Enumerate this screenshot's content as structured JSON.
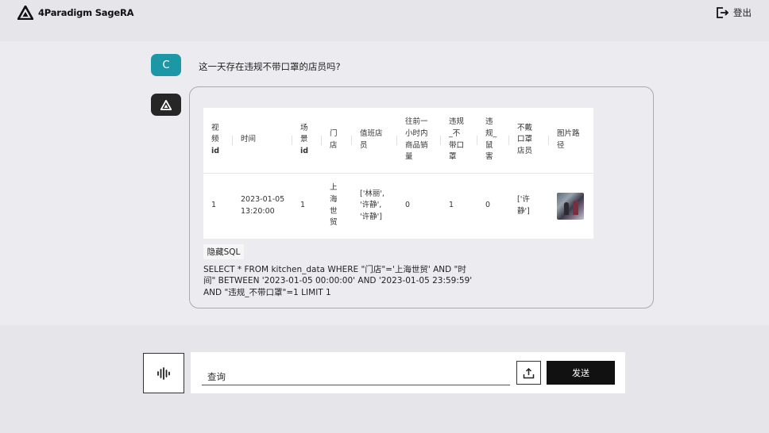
{
  "header": {
    "brand": "4Paradigm SageRA",
    "logout_label": "登出"
  },
  "chat": {
    "user_avatar": "C",
    "question": "这一天存在违规不带口罩的店员吗?",
    "result": {
      "columns": [
        "视频id",
        "时间",
        "场景id",
        "门店",
        "值班店员",
        "往前一小时内商品销量",
        "违规_不带口罩",
        "违规_鼠害",
        "不戴口罩店员",
        "图片路径"
      ],
      "column_lines": [
        [
          "视",
          "频",
          "id"
        ],
        [
          "时间"
        ],
        [
          "场",
          "景",
          "id"
        ],
        [
          "门",
          "店"
        ],
        [
          "值班店",
          "员"
        ],
        [
          "往前一",
          "小时内",
          "商品销",
          "量"
        ],
        [
          "违规",
          "_不",
          "带口",
          "罩"
        ],
        [
          "违",
          "规_",
          "鼠",
          "害"
        ],
        [
          "不戴",
          "口罩",
          "店员"
        ],
        [
          "图片路",
          "径"
        ]
      ],
      "rows": [
        {
          "cells": [
            [
              "1"
            ],
            [
              "2023-01-05",
              "13:20:00"
            ],
            [
              "1"
            ],
            [
              "上",
              "海",
              "世",
              "贸"
            ],
            [
              "['林丽',",
              "'许静',",
              "'许静']"
            ],
            [
              "0"
            ],
            [
              "1"
            ],
            [
              "0"
            ],
            [
              "['许",
              "静']"
            ]
          ],
          "image": "store-photo-thumbnail"
        }
      ]
    },
    "hide_sql_label": "隐藏SQL",
    "sql": "SELECT * FROM kitchen_data WHERE \"门店\"='上海世贸' AND \"时间\" BETWEEN '2023-01-05 00:00:00' AND '2023-01-05 23:59:59' AND \"违规_不带口罩\"=1 LIMIT 1"
  },
  "footer": {
    "query_placeholder": "查询",
    "send_label": "发送"
  },
  "icons": {
    "logo": "sagera-logo-icon",
    "logout": "logout-icon",
    "bot": "sagera-logo-icon",
    "voice": "sound-wave-icon",
    "upload": "upload-icon"
  },
  "colors": {
    "user_avatar": "#1c97a6",
    "bot_avatar": "#262626",
    "send_button": "#111111"
  }
}
